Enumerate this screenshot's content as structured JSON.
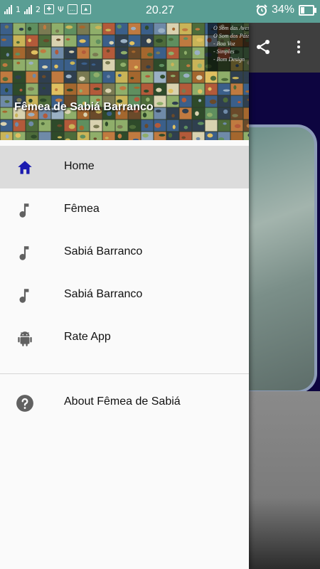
{
  "status_bar": {
    "sim1": "1",
    "sim2": "2",
    "time": "20.27",
    "battery": "34%",
    "battery_level": 0.34
  },
  "drawer": {
    "header": {
      "title": "Fêmea de Sabiá Barranco",
      "caption_lines": [
        "O Som das Aves Fe",
        "O Som dos Pássaro",
        "- Boa Voz",
        "- Simples",
        "- Bom Design"
      ]
    },
    "items": [
      {
        "label": "Home",
        "icon": "home-icon"
      },
      {
        "label": "Fêmea",
        "icon": "music-note-icon"
      },
      {
        "label": "Sabiá Barranco",
        "icon": "music-note-icon"
      },
      {
        "label": "Sabiá Barranco",
        "icon": "music-note-icon"
      },
      {
        "label": "Rate App",
        "icon": "android-icon"
      }
    ],
    "about": {
      "label": "About Fêmea de Sabiá",
      "icon": "help-icon"
    }
  },
  "colors": {
    "accent": "#1b1bb0",
    "icon_gray": "#616161",
    "status_bar": "#5a9e94",
    "background_blue": "#0d0540"
  }
}
